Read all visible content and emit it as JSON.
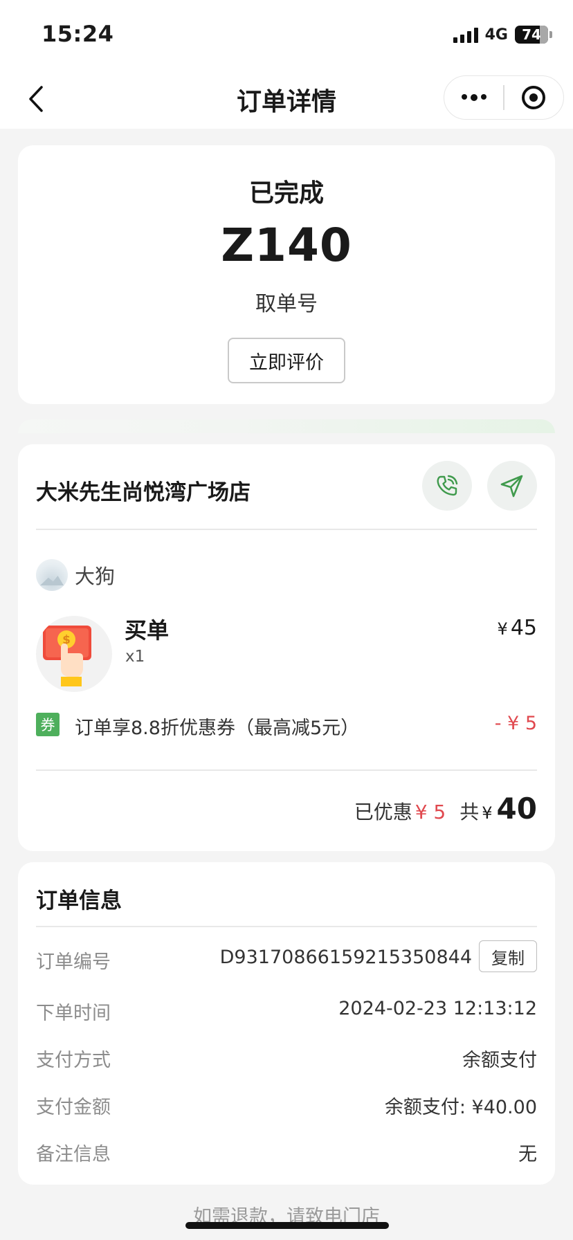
{
  "status_bar": {
    "time": "15:24",
    "network": "4G",
    "battery": "74"
  },
  "nav": {
    "title": "订单详情"
  },
  "order_status": {
    "status": "已完成",
    "pickup_number": "Z140",
    "pickup_label": "取单号",
    "review_button": "立即评价"
  },
  "store": {
    "name": "大米先生尚悦湾广场店",
    "user_name": "大狗",
    "item": {
      "name": "买单",
      "qty": "x1",
      "currency": "¥",
      "price": "45"
    },
    "coupon": {
      "tag": "券",
      "text": "订单享8.8折优惠券（最高减5元）",
      "amount": "- ¥ 5"
    },
    "summary": {
      "discount_label": "已优惠",
      "discount_amount": "¥ 5",
      "total_label": "共",
      "currency": "¥",
      "total_amount": "40"
    }
  },
  "order_info": {
    "title": "订单信息",
    "copy_button": "复制",
    "rows": [
      {
        "label": "订单编号",
        "value": "D93170866159215350844"
      },
      {
        "label": "下单时间",
        "value": "2024-02-23 12:13:12"
      },
      {
        "label": "支付方式",
        "value": "余额支付"
      },
      {
        "label": "支付金额",
        "value": "余额支付: ¥40.00"
      },
      {
        "label": "备注信息",
        "value": "无"
      }
    ]
  },
  "footer": {
    "note": "如需退款，请致电门店"
  },
  "colors": {
    "accent_green": "#4eaf5c",
    "price_red": "#e0484e"
  },
  "icons": [
    "back-arrow-icon",
    "more-dots-icon",
    "record-circle-icon",
    "phone-icon",
    "navigate-arrow-icon",
    "coupon-tag-icon"
  ]
}
